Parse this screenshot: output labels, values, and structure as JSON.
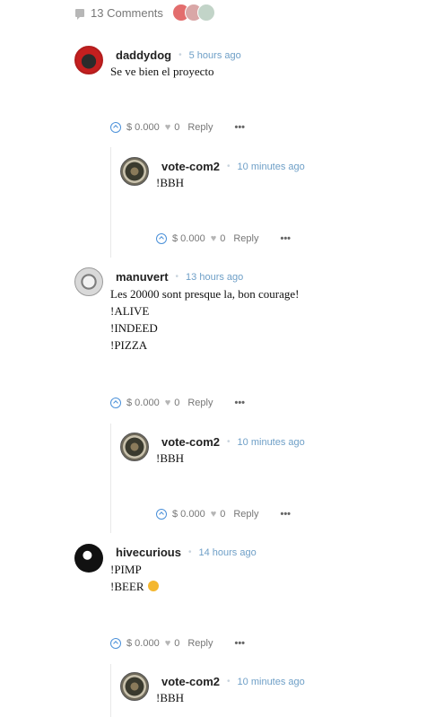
{
  "header": {
    "comment_count_label": "13 Comments"
  },
  "comments": [
    {
      "author": "daddydog",
      "time": "5 hours ago",
      "body": [
        "Se ve bien el proyecto"
      ],
      "footer": {
        "payout": "$ 0.000",
        "likes": "0",
        "reply_label": "Reply",
        "more": "•••"
      },
      "replies": [
        {
          "author": "vote-com2",
          "time": "10 minutes ago",
          "body": [
            "!BBH"
          ],
          "footer": {
            "payout": "$ 0.000",
            "likes": "0",
            "reply_label": "Reply",
            "more": "•••"
          }
        }
      ]
    },
    {
      "author": "manuvert",
      "time": "13 hours ago",
      "body": [
        "Les 20000 sont presque la, bon courage!",
        "!ALIVE",
        "!INDEED",
        "!PIZZA"
      ],
      "footer": {
        "payout": "$ 0.000",
        "likes": "0",
        "reply_label": "Reply",
        "more": "•••"
      },
      "replies": [
        {
          "author": "vote-com2",
          "time": "10 minutes ago",
          "body": [
            "!BBH"
          ],
          "footer": {
            "payout": "$ 0.000",
            "likes": "0",
            "reply_label": "Reply",
            "more": "•••"
          }
        }
      ]
    },
    {
      "author": "hivecurious",
      "time": "14 hours ago",
      "body": [
        "!PIMP",
        "!BEER"
      ],
      "footer": {
        "payout": "$ 0.000",
        "likes": "0",
        "reply_label": "Reply",
        "more": "•••"
      },
      "replies": [
        {
          "author": "vote-com2",
          "time": "10 minutes ago",
          "body": [
            "!BBH"
          ]
        }
      ]
    }
  ]
}
